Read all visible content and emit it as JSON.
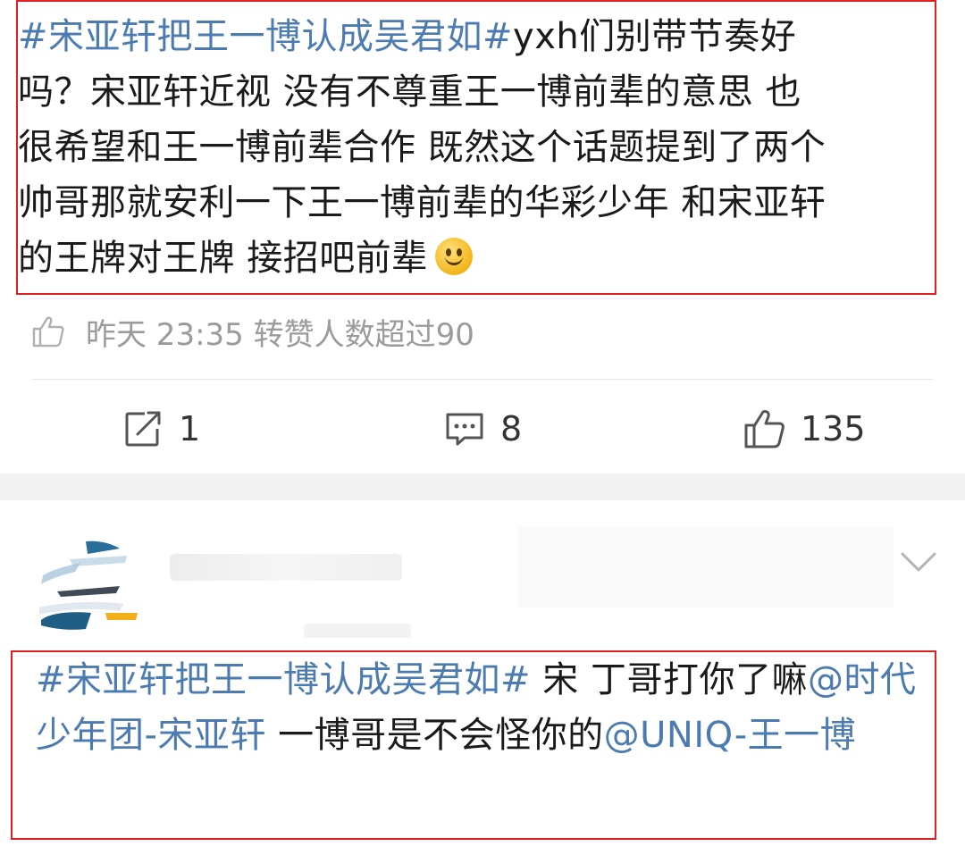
{
  "post1": {
    "hashtag": "#宋亚轩把王一博认成吴君如#",
    "lines": [
      "yxh们别带节奏好",
      "吗？宋亚轩近视 没有不尊重王一博前辈的意思 也",
      "很希望和王一博前辈合作 既然这个话题提到了两个",
      "帅哥那就安利一下王一博前辈的华彩少年 和宋亚轩",
      "的王牌对王牌 接招吧前辈"
    ],
    "emoji": "smile-emoji",
    "meta": "昨天 23:35 转赞人数超过90",
    "actions": {
      "share_count": "1",
      "comment_count": "8",
      "like_count": "135"
    }
  },
  "post2": {
    "hashtag": "#宋亚轩把王一博认成吴君如#",
    "text1": " 宋 丁哥打你了嘛",
    "mention1": "@时代少年团-宋亚轩",
    "text2": " 一博哥是不会怪你的",
    "mention2": "@UNIQ-王一博"
  },
  "colors": {
    "link": "#4b7bb1",
    "highlight_border": "#e02020",
    "meta_gray": "#9b9b9b"
  }
}
